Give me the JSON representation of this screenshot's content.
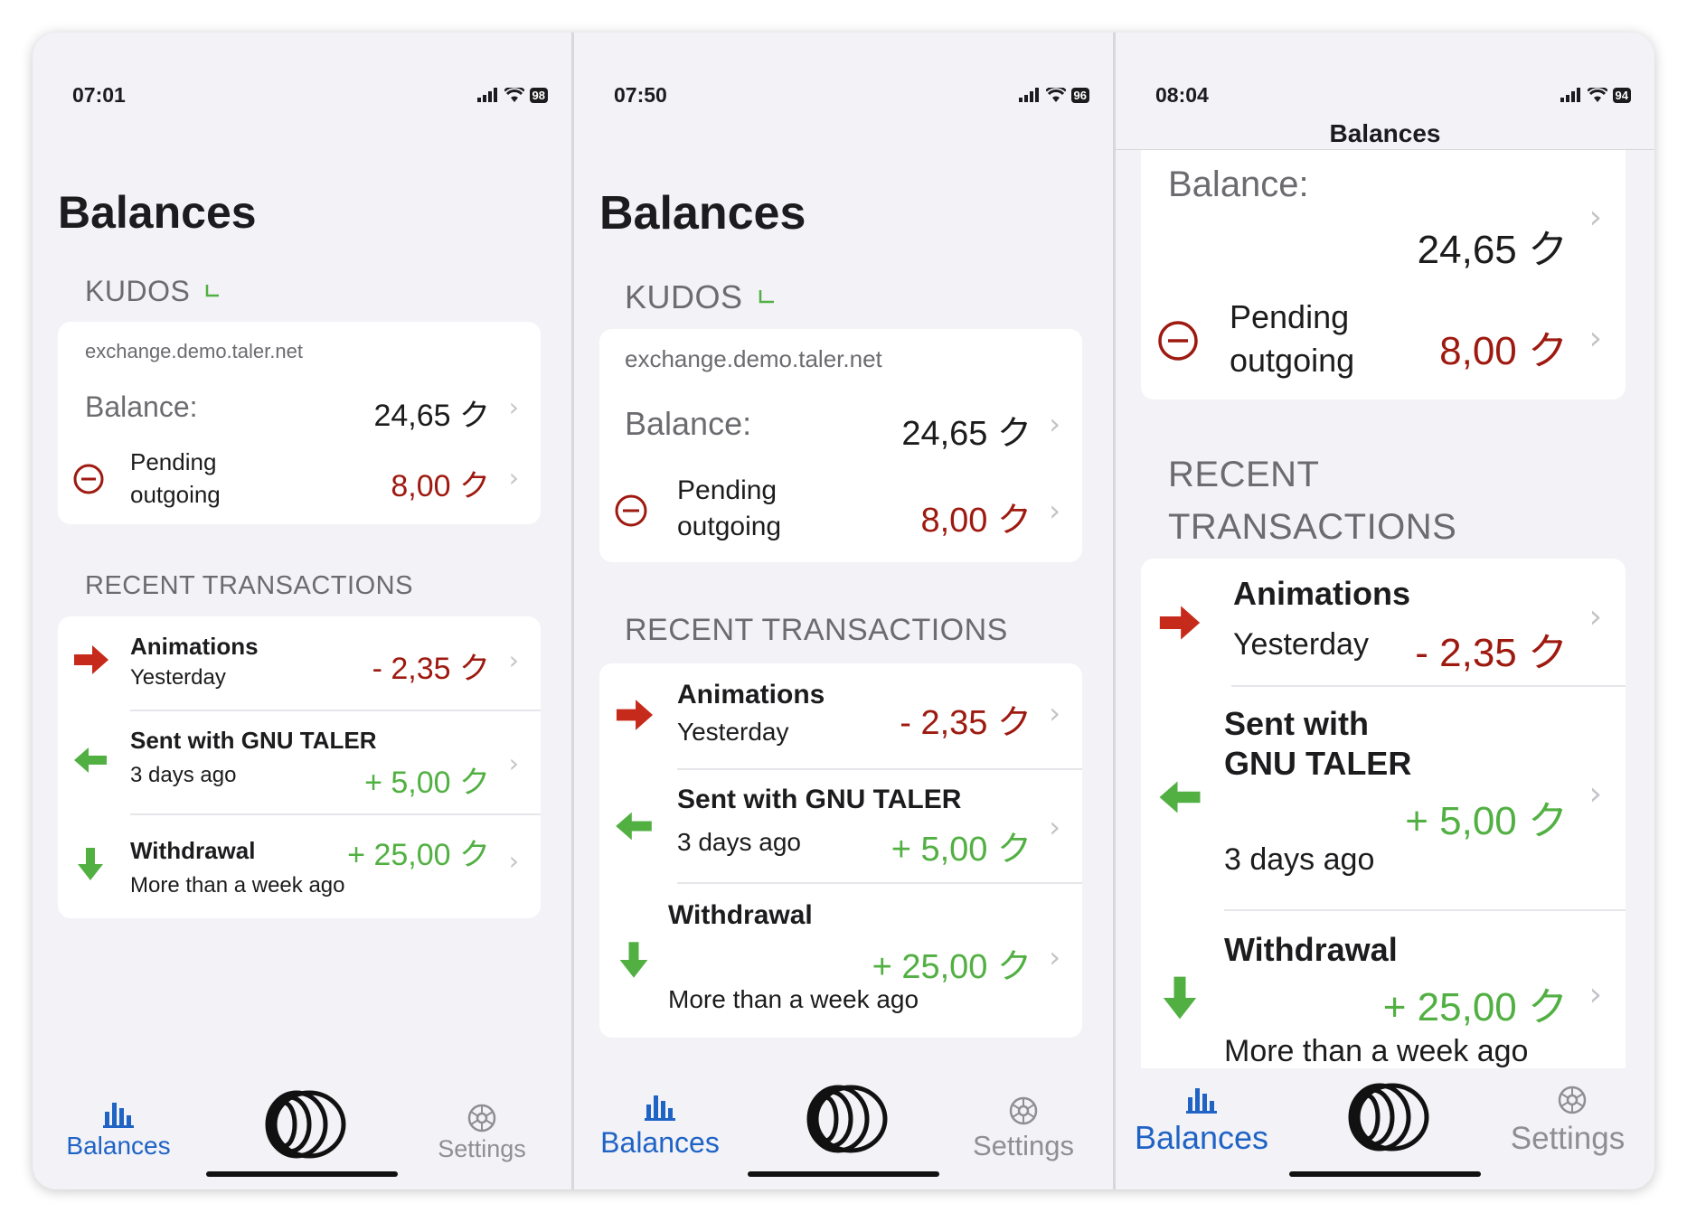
{
  "screens": [
    {
      "time": "07:01",
      "battery": "98",
      "title": "Balances",
      "currency": "KUDOS",
      "exchange": "exchange.demo.taler.net",
      "balance_label": "Balance:",
      "balance_value": "24,65 ク",
      "pending_line1": "Pending",
      "pending_line2": "outgoing",
      "pending_value": "8,00 ク",
      "recent_header": "RECENT TRANSACTIONS",
      "transactions": [
        {
          "title": "Animations",
          "date": "Yesterday",
          "amount": "- 2,35 ク",
          "direction": "outgoing"
        },
        {
          "title": "Sent with GNU TALER",
          "date": "3 days ago",
          "amount": "+ 5,00 ク",
          "direction": "incoming"
        },
        {
          "title": "Withdrawal",
          "date": "More than a week ago",
          "amount": "+ 25,00 ク",
          "direction": "withdrawal"
        }
      ],
      "tabs": {
        "balances": "Balances",
        "settings": "Settings"
      }
    },
    {
      "time": "07:50",
      "battery": "96",
      "title": "Balances",
      "currency": "KUDOS",
      "exchange": "exchange.demo.taler.net",
      "balance_label": "Balance:",
      "balance_value": "24,65 ク",
      "pending_line1": "Pending",
      "pending_line2": "outgoing",
      "pending_value": "8,00 ク",
      "recent_header": "RECENT TRANSACTIONS",
      "transactions": [
        {
          "title": "Animations",
          "date": "Yesterday",
          "amount": "- 2,35 ク",
          "direction": "outgoing"
        },
        {
          "title": "Sent with GNU TALER",
          "date": "3 days ago",
          "amount": "+ 5,00 ク",
          "direction": "incoming"
        },
        {
          "title": "Withdrawal",
          "date": "More than a week ago",
          "amount": "+ 25,00 ク",
          "direction": "withdrawal"
        }
      ],
      "tabs": {
        "balances": "Balances",
        "settings": "Settings"
      }
    },
    {
      "time": "08:04",
      "battery": "94",
      "nav_title": "Balances",
      "balance_label_partial": "Balance:",
      "balance_value": "24,65 ク",
      "pending_line1": "Pending",
      "pending_line2": "outgoing",
      "pending_value": "8,00 ク",
      "recent_line1": "RECENT",
      "recent_line2": "TRANSACTIONS",
      "transactions": [
        {
          "title": "Animations",
          "date": "Yesterday",
          "amount": "- 2,35 ク",
          "direction": "outgoing"
        },
        {
          "title_line1": "Sent with",
          "title_line2": "GNU TALER",
          "date": "3 days ago",
          "amount": "+ 5,00 ク",
          "direction": "incoming"
        },
        {
          "title": "Withdrawal",
          "date": "More than a week ago",
          "amount": "+ 25,00 ク",
          "direction": "withdrawal"
        }
      ],
      "tabs": {
        "balances": "Balances",
        "settings": "Settings"
      }
    }
  ],
  "colors": {
    "accent": "#1f63c5",
    "outgoing": "#9e1a10",
    "incoming": "#52b043",
    "arrow_red": "#c62a1a",
    "background": "#f2f2f7"
  },
  "icons": {
    "arrow_outgoing": "right-arrow-icon",
    "arrow_incoming": "left-arrow-icon",
    "arrow_withdrawal": "down-arrow-icon",
    "pending": "minus-circle-icon",
    "balances_tab": "bar-chart-icon",
    "center": "taler-logo-icon",
    "settings_tab": "gear-icon"
  }
}
